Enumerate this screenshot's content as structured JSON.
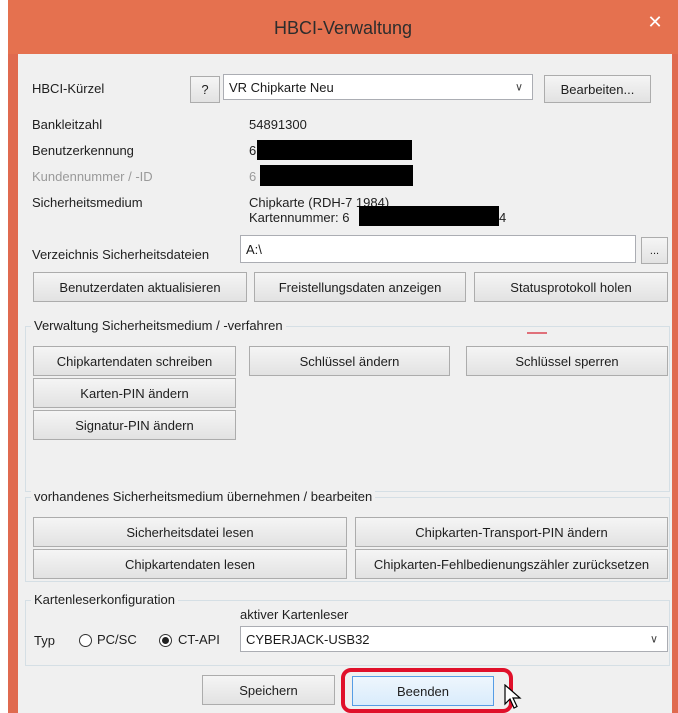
{
  "window": {
    "title": "HBCI-Verwaltung",
    "close_icon": "close-icon",
    "accent_color": "#e5714f"
  },
  "account": {
    "kuerzel_label": "HBCI-Kürzel",
    "help_label": "?",
    "kuerzel_value": "VR Chipkarte Neu",
    "edit_label": "Bearbeiten...",
    "blz_label": "Bankleitzahl",
    "blz_value": "54891300",
    "user_label": "Benutzerkennung",
    "user_value": "6",
    "customer_label": "Kundennummer / -ID",
    "customer_value": "6",
    "medium_label": "Sicherheitsmedium",
    "medium_line1": "Chipkarte  (RDH-7 1984)",
    "medium_line2": "Kartennummer: 6",
    "medium_line2_suffix": "4",
    "dir_label": "Verzeichnis Sicherheitsdateien",
    "dir_value": "A:\\",
    "browse_label": "..."
  },
  "actions": {
    "update_user": "Benutzerdaten aktualisieren",
    "show_release": "Freistellungsdaten anzeigen",
    "fetch_status": "Statusprotokoll holen"
  },
  "admin_group": {
    "title": "Verwaltung Sicherheitsmedium / -verfahren",
    "write_card": "Chipkartendaten schreiben",
    "change_key": "Schlüssel ändern",
    "lock_key": "Schlüssel sperren",
    "change_card_pin": "Karten-PIN ändern",
    "change_sig_pin": "Signatur-PIN ändern"
  },
  "import_group": {
    "title": "vorhandenes Sicherheitsmedium übernehmen / bearbeiten",
    "read_file": "Sicherheitsdatei lesen",
    "change_transport_pin": "Chipkarten-Transport-PIN ändern",
    "read_card": "Chipkartendaten lesen",
    "reset_error_counter": "Chipkarten-Fehlbedienungszähler zurücksetzen"
  },
  "reader_group": {
    "title": "Kartenleserkonfiguration",
    "active_label": "aktiver Kartenleser",
    "type_label": "Typ",
    "option_pcsc": "PC/SC",
    "option_ctapi": "CT-API",
    "selected_option": "CT-API",
    "reader_value": "CYBERJACK-USB32"
  },
  "footer": {
    "save": "Speichern",
    "quit": "Beenden"
  }
}
